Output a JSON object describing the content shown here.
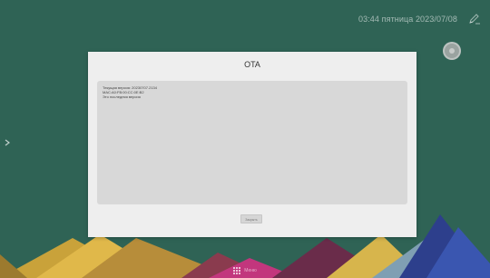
{
  "status_bar": {
    "time_text": "03:44 пятница 2023/07/08",
    "edit_icon": "pencil-icon"
  },
  "dialog": {
    "title": "OTA",
    "info_lines": [
      "Текущая версия: 20230707.2134",
      "MAC:A0:FB:00:CC:0E:B2",
      "Это последняя версия"
    ],
    "ok_label": "Закрыть"
  },
  "dock": {
    "menu_label": "Меню",
    "menu_icon": "grid-icon"
  },
  "colors": {
    "background": "#2f6355",
    "dialog": "#eeeeee",
    "panel": "#d8d8d8"
  }
}
